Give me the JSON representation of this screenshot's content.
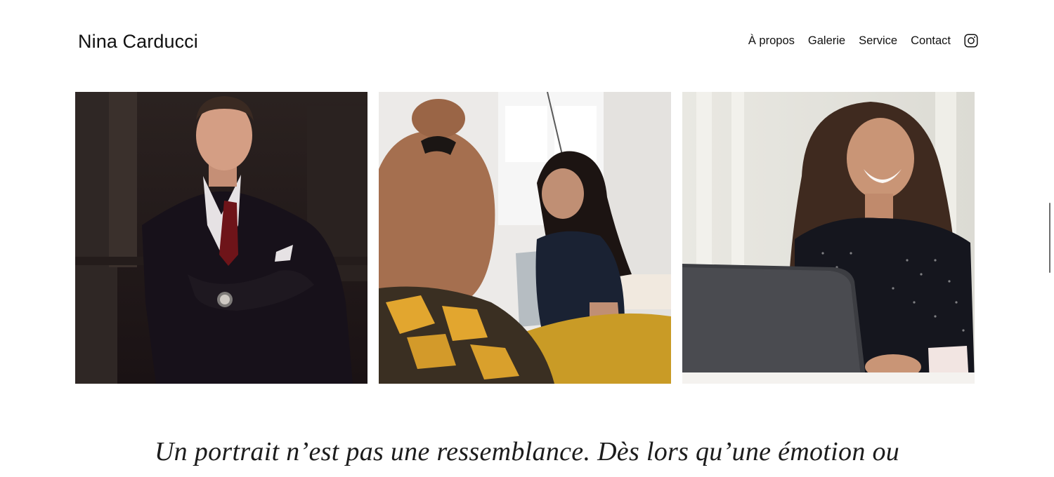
{
  "header": {
    "brand": "Nina Carducci",
    "nav": [
      {
        "label": "À propos"
      },
      {
        "label": "Galerie"
      },
      {
        "label": "Service"
      },
      {
        "label": "Contact"
      }
    ],
    "social_icon": "instagram-icon"
  },
  "gallery": {
    "photos": [
      {
        "subject": "man-in-suit-portrait"
      },
      {
        "subject": "woman-laughing-in-office"
      },
      {
        "subject": "woman-laughing-at-laptop"
      }
    ]
  },
  "quote": {
    "text": "Un portrait n’est pas une ressemblance. Dès lors qu’une émotion ou"
  },
  "colors": {
    "background": "#ffffff",
    "text": "#111111"
  }
}
